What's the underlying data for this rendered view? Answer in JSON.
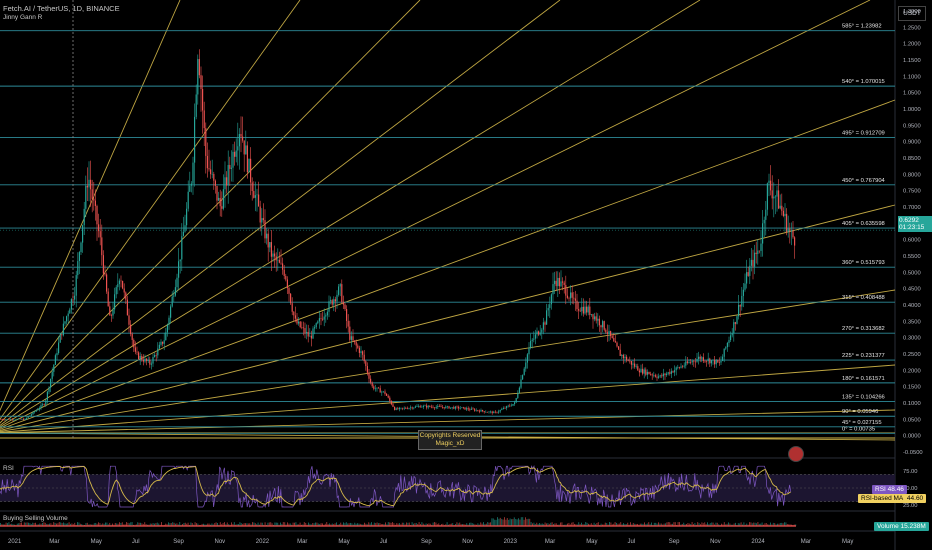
{
  "header": {
    "symbol_line": "Fetch.AI / TetherUS, 1D, BINANCE",
    "indicator": "Jinny Gann R"
  },
  "currency": "USDT",
  "price_tag": {
    "value": "0.6292",
    "countdown": "01:23:15",
    "color": "#26a69a"
  },
  "price_axis": [
    "1.3000",
    "1.2500",
    "1.2000",
    "1.1500",
    "1.1000",
    "1.0500",
    "1.0000",
    "0.9500",
    "0.9000",
    "0.8500",
    "0.8000",
    "0.7500",
    "0.7000",
    "0.6500",
    "0.6000",
    "0.5500",
    "0.5000",
    "0.4500",
    "0.4000",
    "0.3500",
    "0.3000",
    "0.2500",
    "0.2000",
    "0.1500",
    "0.1000",
    "0.0500",
    "0.0000",
    "-0.0500"
  ],
  "gann_levels": [
    {
      "label": "585° = 1.23982",
      "value": 1.23982
    },
    {
      "label": "540° = 1.070015",
      "value": 1.070015
    },
    {
      "label": "495° = 0.912709",
      "value": 0.912709
    },
    {
      "label": "450° = 0.767904",
      "value": 0.767904
    },
    {
      "label": "405° = 0.635598",
      "value": 0.635598
    },
    {
      "label": "360° = 0.515793",
      "value": 0.515793
    },
    {
      "label": "315° = 0.408488",
      "value": 0.408488
    },
    {
      "label": "270° = 0.313682",
      "value": 0.313682
    },
    {
      "label": "225° = 0.231377",
      "value": 0.231377
    },
    {
      "label": "180° = 0.161571",
      "value": 0.161571
    },
    {
      "label": "135° = 0.104266",
      "value": 0.104266
    },
    {
      "label": "90° = 0.05946",
      "value": 0.05946
    },
    {
      "label": "45° = 0.027155",
      "value": 0.027155
    },
    {
      "label": "0° = 0.00735",
      "value": 0.00735
    }
  ],
  "watermark": {
    "line1": "Copyrights Reserved",
    "line2": "Magic_xD"
  },
  "rsi": {
    "title": "RSI",
    "axis": [
      "75.00",
      "50.00",
      "25.00"
    ],
    "rsi_tag": {
      "label": "RSI",
      "value": "48.46"
    },
    "ma_tag": {
      "label": "RSI-based MA",
      "value": "44.60"
    }
  },
  "volume": {
    "title": "Buying Selling Volume",
    "tag": {
      "label": "Volume",
      "value": "15.238M"
    }
  },
  "time_axis": [
    "2021",
    "Mar",
    "May",
    "Jul",
    "Sep",
    "Nov",
    "2022",
    "Mar",
    "May",
    "Jul",
    "Sep",
    "Nov",
    "2023",
    "Mar",
    "May",
    "Jul",
    "Sep",
    "Nov",
    "2024",
    "Mar",
    "May"
  ],
  "colors": {
    "up": "#26a69a",
    "down": "#ef5350",
    "gann_h": "#2e8b99",
    "fan": "#d4b84a",
    "rsi": "#7e57c2",
    "rsi_ma": "#d4b84a"
  }
}
